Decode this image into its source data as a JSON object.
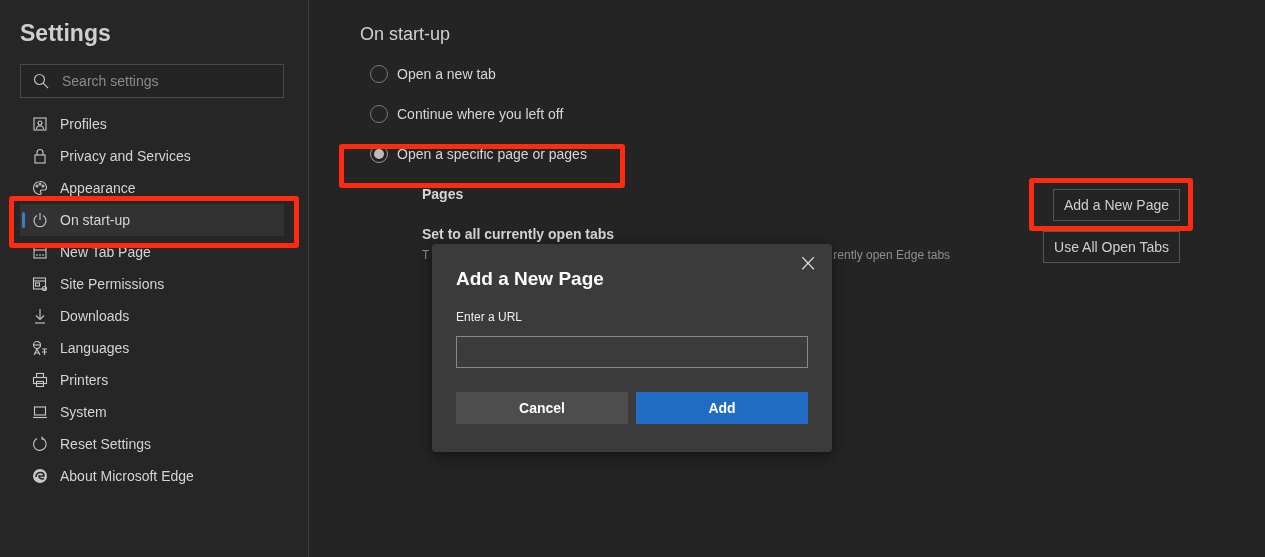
{
  "sidebar": {
    "title": "Settings",
    "search": {
      "placeholder": "Search settings"
    },
    "items": [
      {
        "label": "Profiles",
        "selected": false
      },
      {
        "label": "Privacy and Services",
        "selected": false
      },
      {
        "label": "Appearance",
        "selected": false
      },
      {
        "label": "On start-up",
        "selected": true
      },
      {
        "label": "New Tab Page",
        "selected": false
      },
      {
        "label": "Site Permissions",
        "selected": false
      },
      {
        "label": "Downloads",
        "selected": false
      },
      {
        "label": "Languages",
        "selected": false
      },
      {
        "label": "Printers",
        "selected": false
      },
      {
        "label": "System",
        "selected": false
      },
      {
        "label": "Reset Settings",
        "selected": false
      },
      {
        "label": "About Microsoft Edge",
        "selected": false
      }
    ]
  },
  "main": {
    "title": "On start-up",
    "options": [
      {
        "label": "Open a new tab",
        "selected": false
      },
      {
        "label": "Continue where you left off",
        "selected": false
      },
      {
        "label": "Open a specific page or pages",
        "selected": true
      }
    ],
    "pages_label": "Pages",
    "set_heading": "Set to all currently open tabs",
    "set_description_start": "T",
    "set_description_end": "rently open Edge tabs",
    "buttons": [
      "Add a New Page",
      "Use All Open Tabs"
    ]
  },
  "dialog": {
    "title": "Add a New Page",
    "close": "×",
    "field_label": "Enter a URL",
    "buttons": [
      {
        "label": "Cancel",
        "kind": "secondary"
      },
      {
        "label": "Add",
        "kind": "primary"
      }
    ]
  }
}
